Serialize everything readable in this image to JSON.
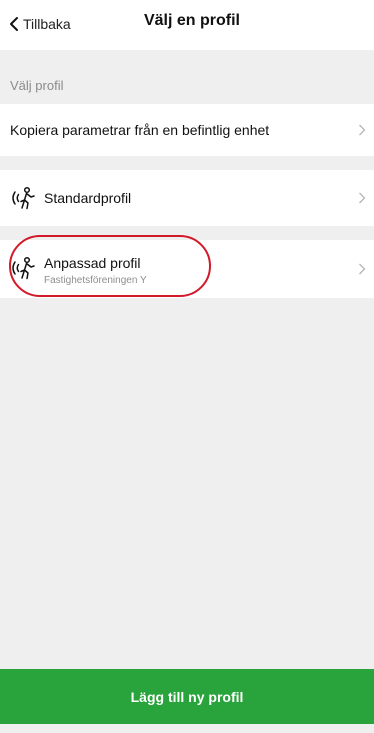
{
  "header": {
    "back_label": "Tillbaka",
    "title": "Välj en profil"
  },
  "section_label": "Välj profil",
  "rows": {
    "copy_label": "Kopiera parametrar från en befintlig enhet",
    "standard_label": "Standardprofil",
    "custom_label": "Anpassad profil",
    "custom_sublabel": "Fastighetsföreningen Y"
  },
  "icons": {
    "back": "chevron-left-icon",
    "row_chevron": "chevron-right-icon",
    "profile": "person-sensor-icon"
  },
  "colors": {
    "accent_green": "#29a33b",
    "highlight_red": "#d11a2a"
  },
  "footer": {
    "add_button_label": "Lägg till ny profil"
  }
}
